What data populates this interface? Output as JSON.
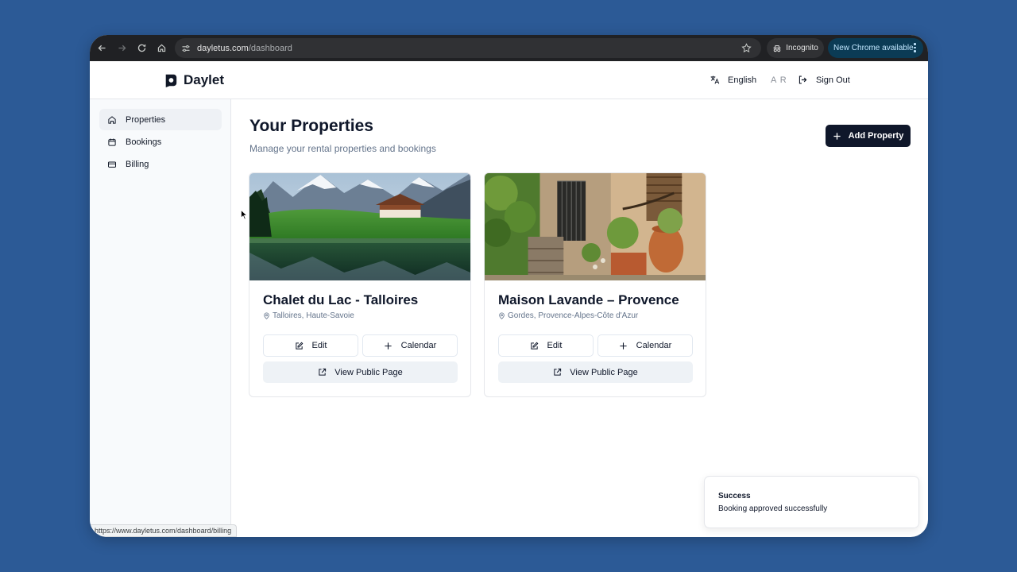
{
  "browser": {
    "url_domain": "dayletus.com",
    "url_path": "/dashboard",
    "incognito_label": "Incognito",
    "update_label": "New Chrome available",
    "status_url": "https://www.dayletus.com/dashboard/billing"
  },
  "header": {
    "brand": "Daylet",
    "language": "English",
    "alt_language": "A R",
    "signout": "Sign Out"
  },
  "sidebar": {
    "items": [
      {
        "label": "Properties",
        "icon": "home-icon",
        "active": true
      },
      {
        "label": "Bookings",
        "icon": "calendar-icon",
        "active": false
      },
      {
        "label": "Billing",
        "icon": "credit-card-icon",
        "active": false
      }
    ]
  },
  "main": {
    "title": "Your Properties",
    "subtitle": "Manage your rental properties and bookings",
    "add_button": "Add Property"
  },
  "properties": [
    {
      "name": "Chalet du Lac - Talloires",
      "location": "Talloires, Haute-Savoie",
      "edit": "Edit",
      "calendar": "Calendar",
      "public": "View Public Page"
    },
    {
      "name": "Maison Lavande – Provence",
      "location": "Gordes, Provence-Alpes-Côte d'Azur",
      "edit": "Edit",
      "calendar": "Calendar",
      "public": "View Public Page"
    }
  ],
  "toast": {
    "title": "Success",
    "message": "Booking approved successfully"
  },
  "colors": {
    "background": "#2c5a96",
    "primary_button": "#0f172a",
    "sidebar_bg": "#f8fafc"
  }
}
